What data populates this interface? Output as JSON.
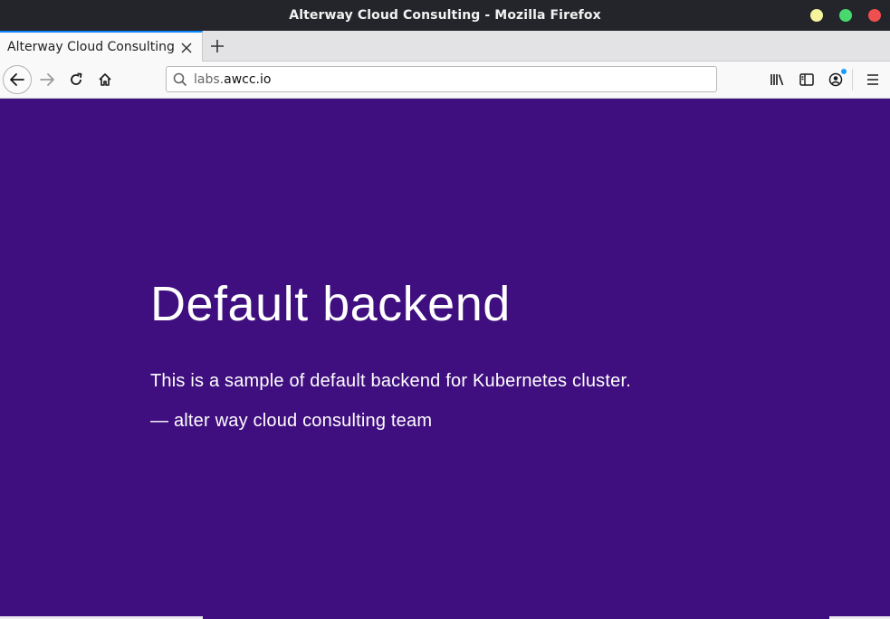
{
  "window": {
    "title": "Alterway Cloud Consulting - Mozilla Firefox"
  },
  "tabs": [
    {
      "label": "Alterway Cloud Consulting",
      "active": true
    }
  ],
  "urlbar": {
    "prefix": "labs.",
    "domain": "awcc.io"
  },
  "page": {
    "heading": "Default backend",
    "description": "This is a sample of default backend for Kubernetes cluster.",
    "signature": "— alter way cloud consulting team"
  },
  "colors": {
    "background": "#3f0e7f",
    "text": "#ffffff",
    "titlebar": "#24252b",
    "tab_accent": "#0a84ff"
  },
  "icons": [
    "back-icon",
    "forward-icon",
    "reload-icon",
    "home-icon",
    "search-icon",
    "library-icon",
    "sidebar-icon",
    "account-icon",
    "menu-icon",
    "close-icon",
    "plus-icon"
  ]
}
